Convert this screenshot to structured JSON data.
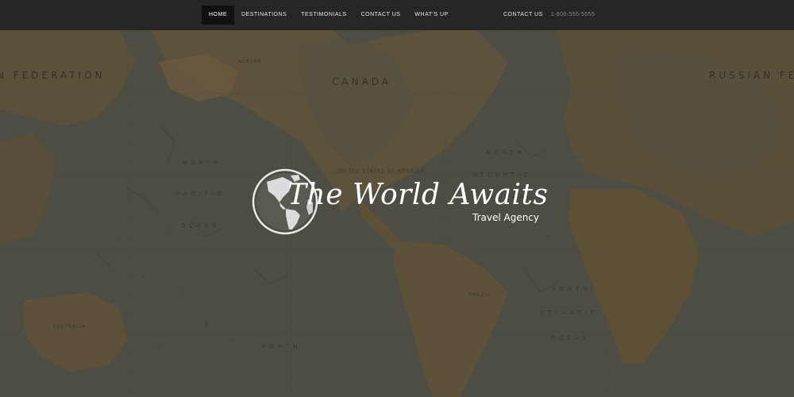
{
  "nav": {
    "items": [
      {
        "label": "HOME",
        "active": true
      },
      {
        "label": "DESTINATIONS",
        "active": false
      },
      {
        "label": "TESTIMONIALS",
        "active": false
      },
      {
        "label": "CONTACT US",
        "active": false
      },
      {
        "label": "WHAT'S UP",
        "active": false
      }
    ],
    "contact_label": "CONTACT US",
    "phone": "1-800-555-5555"
  },
  "hero": {
    "map_labels": {
      "russian_federation_left": "N FEDERATION",
      "canada": "CANADA",
      "russian_federation_right": "RUSSIAN FEDERATION",
      "north_pacific_1": "NORTH",
      "north_pacific_2": "PACIFIC",
      "north_pacific_3": "OCEAN",
      "north_atlantic_1": "NORTH",
      "north_atlantic_2": "ATLANTIC",
      "north_atlantic_3": "OCEAN",
      "south_atlantic_1": "SOUTH",
      "south_atlantic_2": "ATLANTIC",
      "south_atlantic_3": "OCEAN",
      "south_pacific": "SOUTH",
      "usa": "UNITED STATES OF AMERICA",
      "brazil": "BRAZIL",
      "australia": "AUSTRALIA",
      "alaska": "ALASKA"
    },
    "logo": {
      "title": "The World Awaits",
      "subtitle": "Travel Agency"
    }
  },
  "colors": {
    "nav_background": "#262626",
    "nav_active": "#111111",
    "map_ocean": "#5a5a4e",
    "map_land": "#6b5a3a",
    "logo_text": "#ffffff"
  }
}
